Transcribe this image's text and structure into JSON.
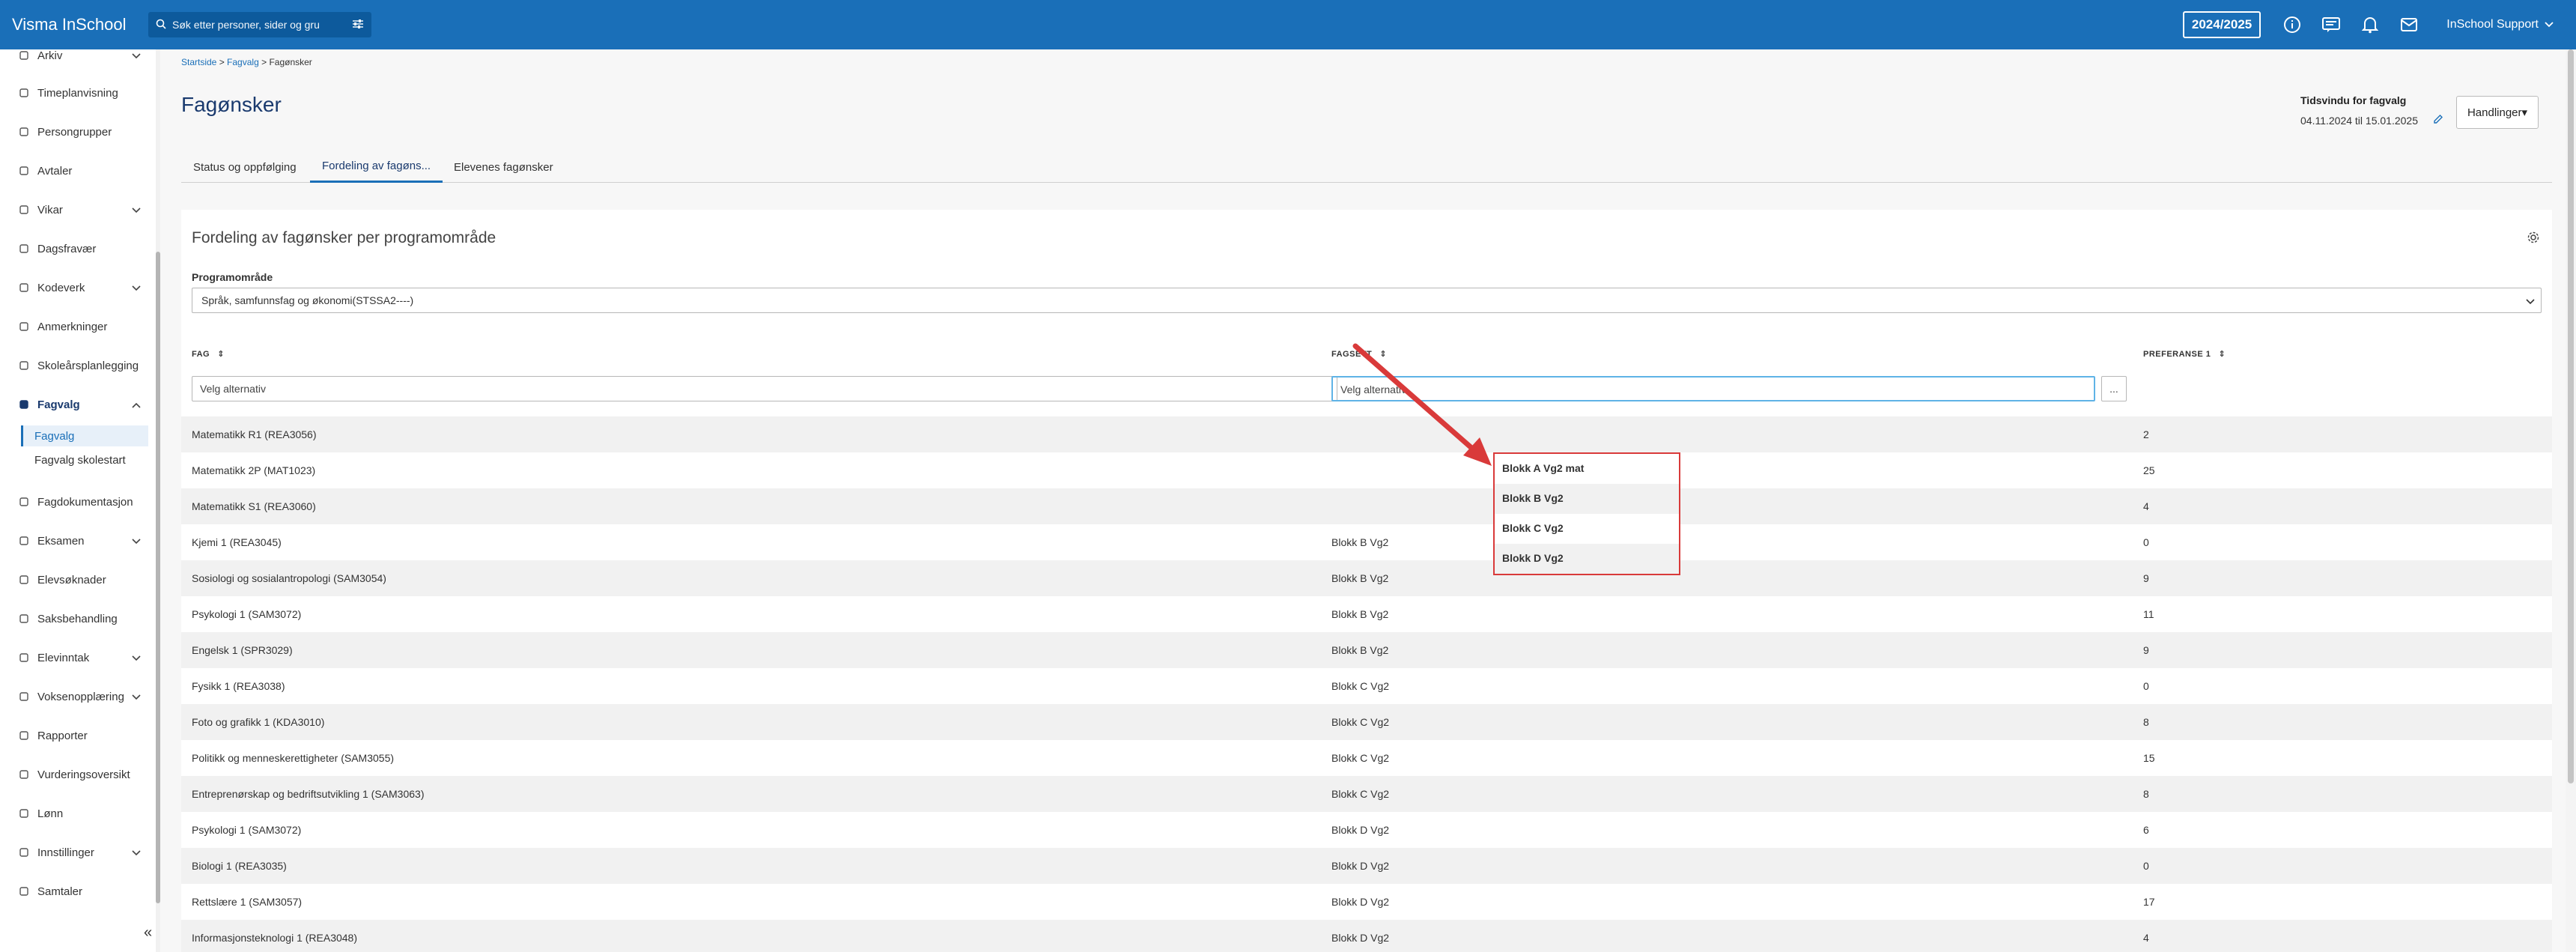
{
  "app": {
    "title": "Visma InSchool",
    "search_placeholder": "Søk etter personer, sider og gru",
    "year": "2024/2025",
    "user": "InSchool Support"
  },
  "sidebar": {
    "items": [
      {
        "label": "Arkiv",
        "icon": "archive-icon",
        "chevron": true
      },
      {
        "label": "Timeplanvisning",
        "icon": "calendar-icon"
      },
      {
        "label": "Persongrupper",
        "icon": "group-icon"
      },
      {
        "label": "Avtaler",
        "icon": "handshake-icon"
      },
      {
        "label": "Vikar",
        "icon": "swap-icon",
        "chevron": true
      },
      {
        "label": "Dagsfravær",
        "icon": "person-icon"
      },
      {
        "label": "Kodeverk",
        "icon": "code-icon",
        "chevron": true
      },
      {
        "label": "Anmerkninger",
        "icon": "comment-icon"
      },
      {
        "label": "Skoleårsplanlegging",
        "icon": "calendar-icon"
      },
      {
        "label": "Fagvalg",
        "icon": "book-icon",
        "chevron": true,
        "expanded": true
      },
      {
        "label": "Fagdokumentasjon",
        "icon": "document-icon"
      },
      {
        "label": "Eksamen",
        "icon": "exam-icon",
        "chevron": true
      },
      {
        "label": "Elevsøknader",
        "icon": "application-icon"
      },
      {
        "label": "Saksbehandling",
        "icon": "folder-icon"
      },
      {
        "label": "Elevinntak",
        "icon": "person-add-icon",
        "chevron": true
      },
      {
        "label": "Voksenopplæring",
        "icon": "adult-icon",
        "chevron": true
      },
      {
        "label": "Rapporter",
        "icon": "report-icon"
      },
      {
        "label": "Vurderingsoversikt",
        "icon": "list-icon"
      },
      {
        "label": "Lønn",
        "icon": "money-icon"
      },
      {
        "label": "Innstillinger",
        "icon": "settings-icon",
        "chevron": true
      },
      {
        "label": "Samtaler",
        "icon": "chat-icon"
      }
    ],
    "sub_items": [
      "Fagvalg",
      "Fagvalg skolestart"
    ]
  },
  "breadcrumb": {
    "home": "Startside",
    "parent": "Fagvalg",
    "current": "Fagønsker"
  },
  "page": {
    "title": "Fagønsker",
    "time_window_label": "Tidsvindu for fagvalg",
    "time_window_dates": "04.11.2024 til 15.01.2025",
    "actions_button": "Handlinger▾"
  },
  "tabs": [
    "Status og oppfølging",
    "Fordeling av fagøns...",
    "Elevenes fagønsker"
  ],
  "card": {
    "title": "Fordeling av fagønsker per programområde",
    "program_label": "Programområde",
    "program_value": "Språk, samfunnsfag og økonomi(STSSA2----)",
    "columns": [
      "FAG",
      "FAGSETT",
      "PREFERANSE 1"
    ],
    "filter_placeholder": "Velg alternativ",
    "filter_button": "..."
  },
  "dropdown_options": [
    "Blokk A Vg2 mat",
    "Blokk B Vg2",
    "Blokk C Vg2",
    "Blokk D Vg2"
  ],
  "table_rows": [
    {
      "fag": "Matematikk R1 (REA3056)",
      "fagsett": "",
      "pref": "2"
    },
    {
      "fag": "Matematikk 2P (MAT1023)",
      "fagsett": "",
      "pref": "25"
    },
    {
      "fag": "Matematikk S1 (REA3060)",
      "fagsett": "",
      "pref": "4"
    },
    {
      "fag": "Kjemi 1 (REA3045)",
      "fagsett": "Blokk B Vg2",
      "pref": "0"
    },
    {
      "fag": "Sosiologi og sosialantropologi (SAM3054)",
      "fagsett": "Blokk B Vg2",
      "pref": "9"
    },
    {
      "fag": "Psykologi 1 (SAM3072)",
      "fagsett": "Blokk B Vg2",
      "pref": "11"
    },
    {
      "fag": "Engelsk 1 (SPR3029)",
      "fagsett": "Blokk B Vg2",
      "pref": "9"
    },
    {
      "fag": "Fysikk 1 (REA3038)",
      "fagsett": "Blokk C Vg2",
      "pref": "0"
    },
    {
      "fag": "Foto og grafikk 1 (KDA3010)",
      "fagsett": "Blokk C Vg2",
      "pref": "8"
    },
    {
      "fag": "Politikk og menneskerettigheter (SAM3055)",
      "fagsett": "Blokk C Vg2",
      "pref": "15"
    },
    {
      "fag": "Entreprenørskap og bedriftsutvikling 1 (SAM3063)",
      "fagsett": "Blokk C Vg2",
      "pref": "8"
    },
    {
      "fag": "Psykologi 1 (SAM3072)",
      "fagsett": "Blokk D Vg2",
      "pref": "6"
    },
    {
      "fag": "Biologi 1 (REA3035)",
      "fagsett": "Blokk D Vg2",
      "pref": "0"
    },
    {
      "fag": "Rettslære 1 (SAM3057)",
      "fagsett": "Blokk D Vg2",
      "pref": "17"
    },
    {
      "fag": "Informasjonsteknologi 1 (REA3048)",
      "fagsett": "Blokk D Vg2",
      "pref": "4"
    }
  ],
  "colors": {
    "topbar": "#1a6fb8",
    "accent": "#1a6fb8",
    "highlight": "#d93a3a"
  }
}
